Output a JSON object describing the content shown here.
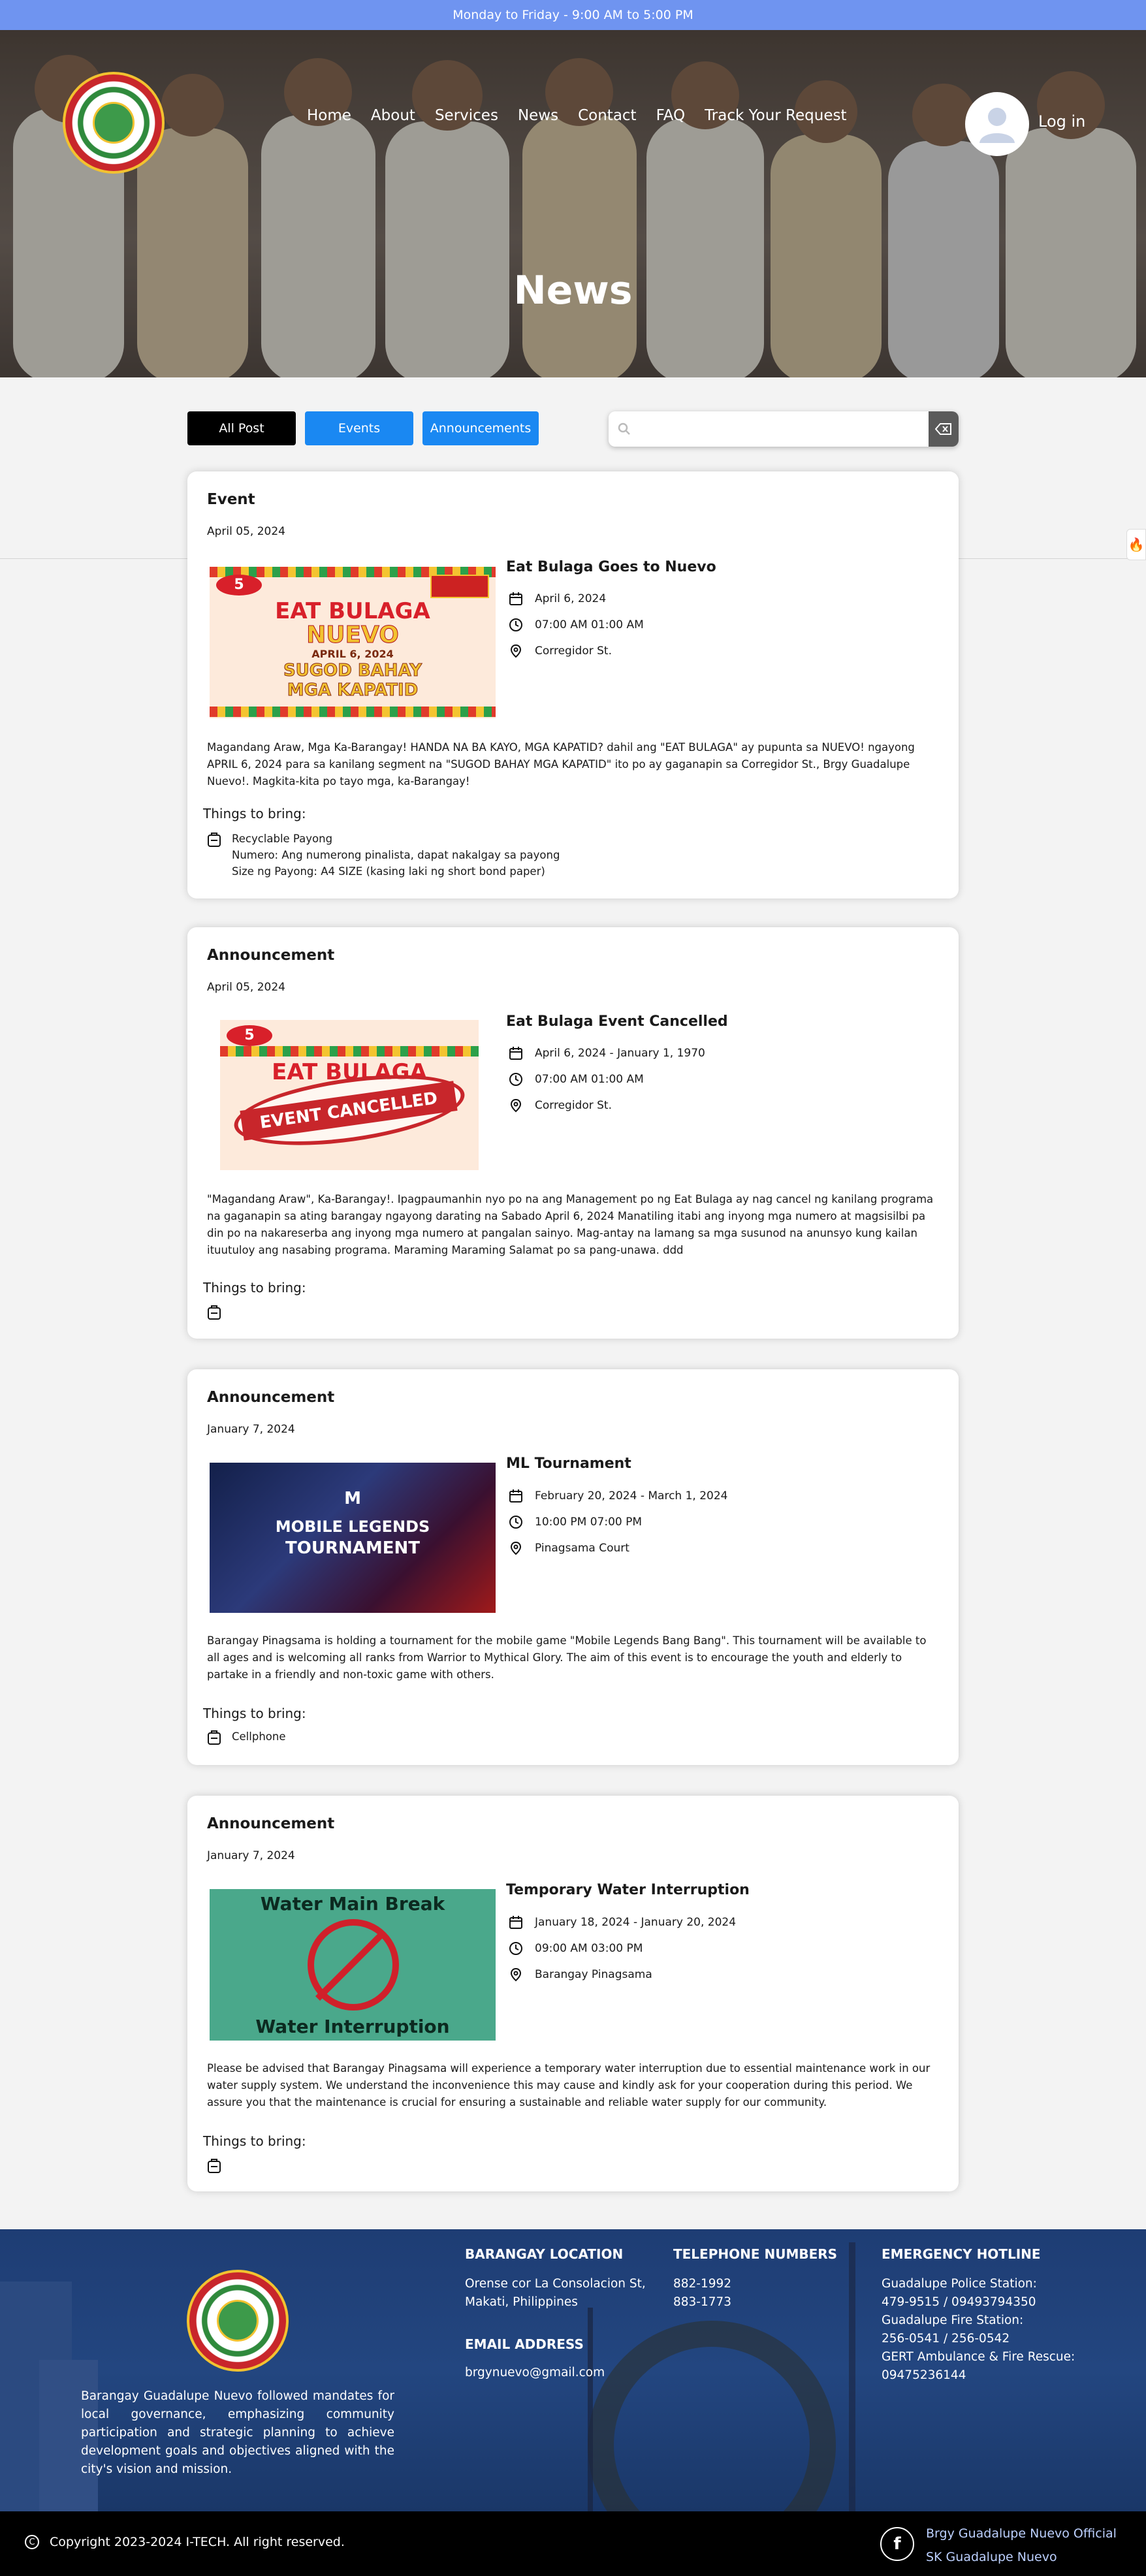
{
  "topbar": {
    "hours": "Monday to Friday - 9:00 AM to 5:00 PM"
  },
  "nav": {
    "items": [
      "Home",
      "About",
      "Services",
      "News",
      "Contact",
      "FAQ",
      "Track Your Request"
    ],
    "login": "Log in"
  },
  "hero": {
    "title": "News"
  },
  "filters": {
    "all": "All Post",
    "events": "Events",
    "announcements": "Announcements"
  },
  "search": {
    "placeholder": "",
    "value": ""
  },
  "posts": [
    {
      "type": "Event",
      "posted": "April 05, 2024",
      "title": "Eat Bulaga Goes to Nuevo",
      "date": "April 6, 2024",
      "time": "07:00 AM 01:00 AM",
      "location": "Corregidor St.",
      "image_text": [
        "EAT BULAGA",
        "NUEVO",
        "APRIL 6, 2024",
        "SUGOD BAHAY",
        "MGA KAPATID"
      ],
      "description": "Magandang Araw, Mga Ka-Barangay! HANDA NA BA KAYO, MGA KAPATID? dahil ang \"EAT BULAGA\" ay pupunta sa NUEVO! ngayong APRIL 6, 2024 para sa kanilang segment na \"SUGOD BAHAY MGA KAPATID\" ito po ay gaganapin sa Corregidor St., Brgy Guadalupe Nuevo!. Magkita-kita po tayo mga, ka-Barangay!",
      "bring_label": "Things to bring:",
      "bring": [
        "Recyclable Payong",
        "Numero: Ang numerong pinalista, dapat nakalgay sa payong",
        "Size ng Payong: A4 SIZE (kasing laki ng short bond paper)"
      ]
    },
    {
      "type": "Announcement",
      "posted": "April 05, 2024",
      "title": "Eat Bulaga Event Cancelled",
      "date": "April 6, 2024 - January 1, 1970",
      "time": "07:00 AM 01:00 AM",
      "location": "Corregidor St.",
      "image_text": [
        "EAT BULAGA",
        "EVENT CANCELLED"
      ],
      "description": "\"Magandang Araw\", Ka-Barangay!. Ipagpaumanhin nyo po na ang Management po ng Eat Bulaga ay nag cancel ng kanilang programa na gaganapin sa ating barangay ngayong darating na Sabado April 6, 2024 Manatiling itabi ang inyong mga numero at magsisilbi pa din po na nakareserba ang inyong mga numero at pangalan sainyo. Mag-antay na lamang sa mga susunod na anunsyo kung kailan ituutuloy ang nasabing programa. Maraming Maraming Salamat po sa pang-unawa. ddd",
      "bring_label": "Things to bring:",
      "bring": [
        ""
      ]
    },
    {
      "type": "Announcement",
      "posted": "January 7, 2024",
      "title": "ML Tournament",
      "date": "February 20, 2024 - March 1, 2024",
      "time": "10:00 PM 07:00 PM",
      "location": "Pinagsama Court",
      "image_text": [
        "MOBILE LEGENDS",
        "TOURNAMENT"
      ],
      "description": "Barangay Pinagsama is holding a tournament for the mobile game \"Mobile Legends Bang Bang\". This tournament will be available to all ages and is welcoming all ranks from Warrior to Mythical Glory. The aim of this event is to encourage the youth and elderly to partake in a friendly and non-toxic game with others.",
      "bring_label": "Things to bring:",
      "bring": [
        "Cellphone"
      ]
    },
    {
      "type": "Announcement",
      "posted": "January 7, 2024",
      "title": "Temporary Water Interruption",
      "date": "January 18, 2024 - January 20, 2024",
      "time": "09:00 AM 03:00 PM",
      "location": "Barangay Pinagsama",
      "image_text": [
        "Water Main Break",
        "Water Interruption"
      ],
      "description": "Please be advised that Barangay Pinagsama will experience a temporary water interruption due to essential maintenance work in our water supply system. We understand the inconvenience this may cause and kindly ask for your cooperation during this period. We assure you that the maintenance is crucial for ensuring a sustainable and reliable water supply for our community.",
      "bring_label": "Things to bring:",
      "bring": [
        ""
      ]
    }
  ],
  "footer": {
    "about": "Barangay Guadalupe Nuevo followed mandates for local governance, emphasizing community participation and strategic planning to achieve development goals and objectives aligned with the city's vision and mission.",
    "location_heading": "BARANGAY LOCATION",
    "location": "Orense cor La Consolacion St, Makati, Philippines",
    "email_heading": "EMAIL ADDRESS",
    "email": "brgynuevo@gmail.com",
    "phone_heading": "TELEPHONE NUMBERS",
    "phones": [
      "882-1992",
      "883-1773"
    ],
    "emergency_heading": "EMERGENCY HOTLINE",
    "emergency": [
      "Guadalupe Police Station:",
      "479-9515 / 09493794350",
      "Guadalupe Fire Station:",
      "256-0541 / 256-0542",
      "GERT Ambulance & Fire Rescue:",
      "09475236144"
    ],
    "copyright": "Copyright 2023-2024 I-TECH. All right reserved.",
    "social": [
      "Brgy Guadalupe Nuevo Official",
      "SK Guadalupe Nuevo"
    ]
  },
  "colors": {
    "topbar": "#6f94f0",
    "accent": "#1a88f2",
    "footer": "#1e3d74"
  },
  "icons": {
    "calendar": "calendar-icon",
    "clock": "clock-icon",
    "location": "location-pin-icon",
    "bring": "bag-icon",
    "search": "search-icon",
    "clear": "clear-icon"
  }
}
